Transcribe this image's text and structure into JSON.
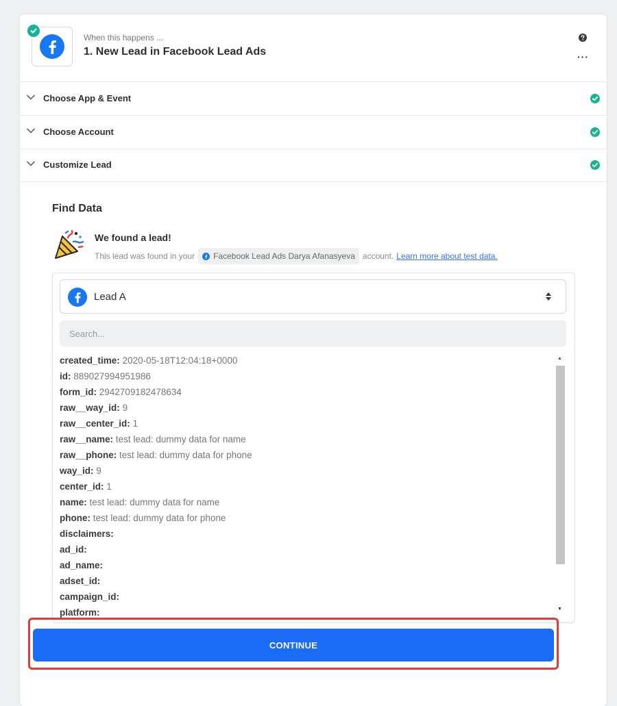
{
  "step": {
    "subtitle": "When this happens ...",
    "title": "1. New Lead in Facebook Lead Ads"
  },
  "sections": [
    {
      "label": "Choose App & Event"
    },
    {
      "label": "Choose Account"
    },
    {
      "label": "Customize Lead"
    }
  ],
  "find_data": {
    "title": "Find Data",
    "found_title": "We found a lead!",
    "found_text": "This lead was found in your",
    "account_chip": "Facebook Lead Ads Darya Afanasyeva",
    "account_suffix": "account.",
    "learn_more": "Learn more about test data."
  },
  "lead_select": {
    "value": "Lead A"
  },
  "search": {
    "placeholder": "Search..."
  },
  "fields": [
    {
      "key": "created_time:",
      "value": "2020-05-18T12:04:18+0000"
    },
    {
      "key": "id:",
      "value": "889027994951986"
    },
    {
      "key": "form_id:",
      "value": "2942709182478634"
    },
    {
      "key": "raw__way_id:",
      "value": "9"
    },
    {
      "key": "raw__center_id:",
      "value": "1"
    },
    {
      "key": "raw__name:",
      "value": "test lead: dummy data for name"
    },
    {
      "key": "raw__phone:",
      "value": "test lead: dummy data for phone"
    },
    {
      "key": "way_id:",
      "value": "9"
    },
    {
      "key": "center_id:",
      "value": "1"
    },
    {
      "key": "name:",
      "value": "test lead: dummy data for name"
    },
    {
      "key": "phone:",
      "value": "test lead: dummy data for phone"
    },
    {
      "key": "disclaimers:",
      "value": ""
    },
    {
      "key": "ad_id:",
      "value": ""
    },
    {
      "key": "ad_name:",
      "value": ""
    },
    {
      "key": "adset_id:",
      "value": ""
    },
    {
      "key": "campaign_id:",
      "value": ""
    },
    {
      "key": "platform:",
      "value": ""
    }
  ],
  "continue_label": "CONTINUE",
  "colors": {
    "accent": "#1a6bf5",
    "success": "#1ab394",
    "facebook": "#1877f2",
    "highlight": "#e43a3a"
  }
}
